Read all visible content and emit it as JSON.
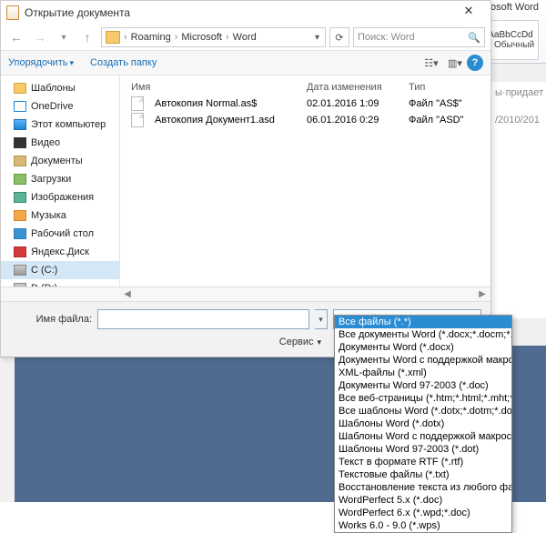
{
  "bg": {
    "word_title": "osoft Word",
    "style_sample": "AaBbCcDd",
    "style_label": "¶ Обычный",
    "page_right_line1": "ы·придает",
    "page_right_line2": "/2010/201"
  },
  "dialog": {
    "title": "Открытие документа",
    "breadcrumb": [
      "Roaming",
      "Microsoft",
      "Word"
    ],
    "search_placeholder": "Поиск: Word",
    "organize": "Упорядочить",
    "new_folder": "Создать папку",
    "tree": [
      {
        "icon": "i-folder",
        "label": "Шаблоны"
      },
      {
        "icon": "i-od",
        "label": "OneDrive"
      },
      {
        "icon": "i-pc",
        "label": "Этот компьютер"
      },
      {
        "icon": "i-vid",
        "label": "Видео"
      },
      {
        "icon": "i-doc",
        "label": "Документы"
      },
      {
        "icon": "i-dl",
        "label": "Загрузки"
      },
      {
        "icon": "i-img",
        "label": "Изображения"
      },
      {
        "icon": "i-mus",
        "label": "Музыка"
      },
      {
        "icon": "i-desk",
        "label": "Рабочий стол"
      },
      {
        "icon": "i-yd",
        "label": "Яндекс.Диск"
      },
      {
        "icon": "i-drv",
        "label": "C (C:)",
        "sel": true
      },
      {
        "icon": "i-drv",
        "label": "D (D:)"
      }
    ],
    "cols": {
      "name": "Имя",
      "date": "Дата изменения",
      "type": "Тип"
    },
    "files": [
      {
        "name": "Автокопия Normal.as$",
        "date": "02.01.2016 1:09",
        "type": "Файл \"AS$\""
      },
      {
        "name": "Автокопия Документ1.asd",
        "date": "06.01.2016 0:29",
        "type": "Файл \"ASD\""
      }
    ],
    "filename_label": "Имя файла:",
    "type_selected": "Все файлы (*.*)",
    "service": "Сервис",
    "type_options": [
      "Все файлы (*.*)",
      "Все документы Word (*.docx;*.docm;*.dotx;*.dotm;*.d",
      "Документы Word (*.docx)",
      "Документы Word с поддержкой макросов (*.docm)",
      "XML-файлы (*.xml)",
      "Документы Word 97-2003 (*.doc)",
      "Все веб-страницы (*.htm;*.html;*.mht;*.mhtml)",
      "Все шаблоны Word (*.dotx;*.dotm;*.dot)",
      "Шаблоны Word (*.dotx)",
      "Шаблоны Word с поддержкой макросов (*.dotm)",
      "Шаблоны Word 97-2003 (*.dot)",
      "Текст в формате RTF (*.rtf)",
      "Текстовые файлы (*.txt)",
      "Восстановление текста из любого файла (*.*)",
      "WordPerfect 5.x (*.doc)",
      "WordPerfect 6.x (*.wpd;*.doc)",
      "Works 6.0 - 9.0 (*.wps)"
    ]
  }
}
